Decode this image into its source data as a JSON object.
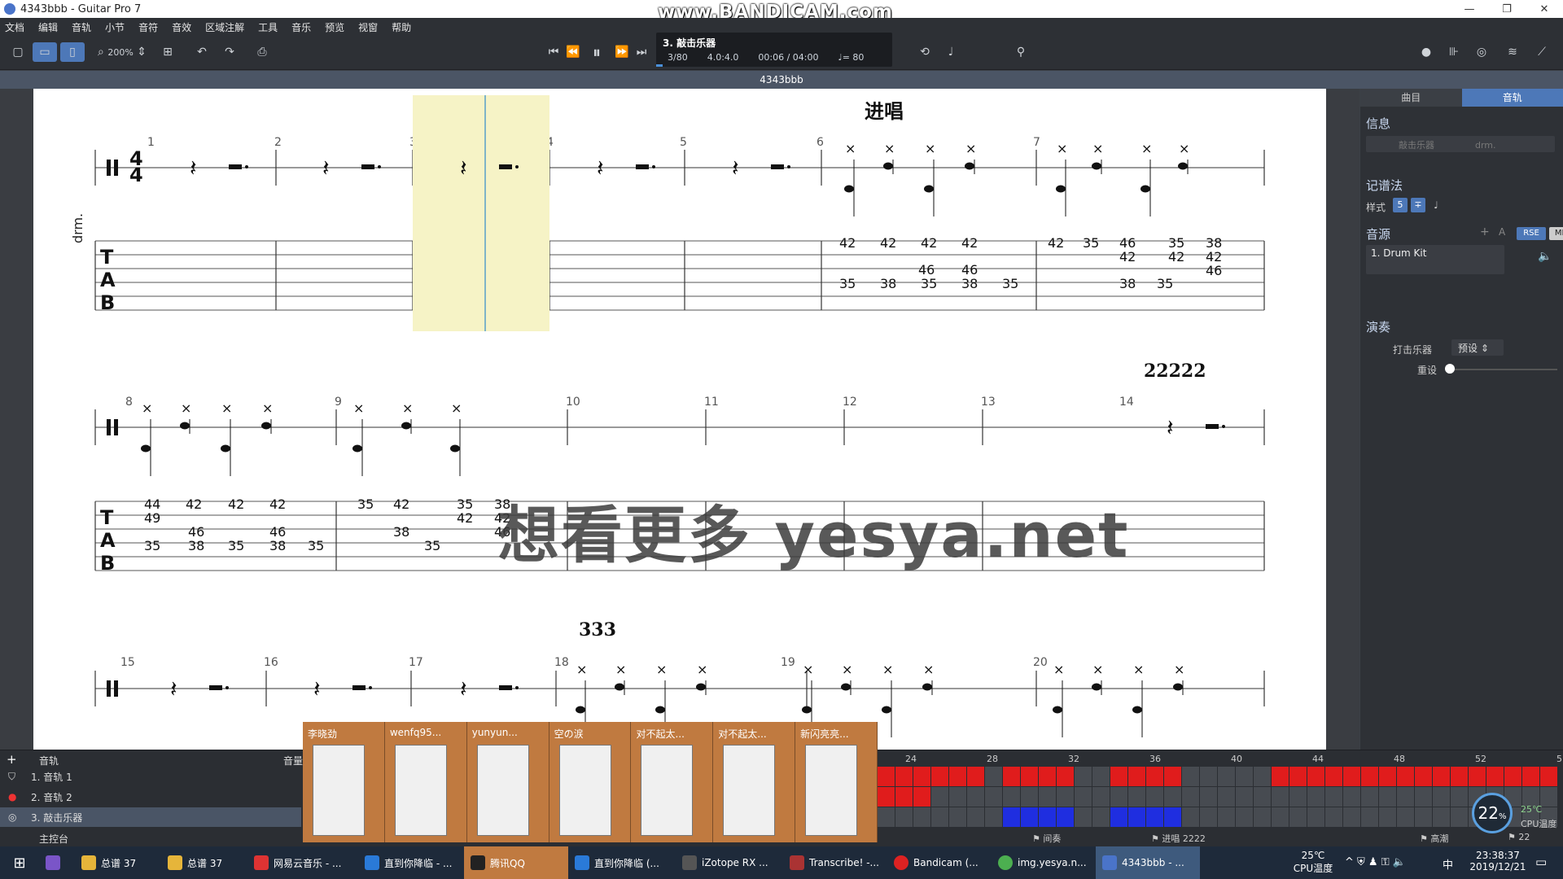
{
  "window": {
    "title": "4343bbb - Guitar Pro 7",
    "watermark": "www.BANDICAM.com"
  },
  "menu": [
    "文档",
    "编辑",
    "音轨",
    "小节",
    "音符",
    "音效",
    "区域注解",
    "工具",
    "音乐",
    "预览",
    "视窗",
    "帮助"
  ],
  "toolbar": {
    "zoom": "200%"
  },
  "lcd": {
    "track": "3. 敲击乐器",
    "bar": "3/80",
    "sig": "4.0:4.0",
    "time": "00:06 / 04:00",
    "tempo": "♩= 80"
  },
  "doc_tab": "4343bbb",
  "score": {
    "sections": [
      "进唱",
      "22222",
      "333"
    ],
    "instrument_label": "drm.",
    "bar_numbers": [
      "1",
      "2",
      "3",
      "4",
      "5",
      "6",
      "7",
      "8",
      "9",
      "10",
      "11",
      "12",
      "13",
      "14",
      "15",
      "16",
      "17",
      "18",
      "19",
      "20"
    ],
    "tab_row1": [
      "42",
      "42",
      "42",
      "42",
      "42",
      "35",
      "46",
      "35",
      "38",
      "46",
      "46",
      "42",
      "42",
      "42",
      "35",
      "38",
      "35",
      "38",
      "35",
      "38",
      "35",
      "46"
    ],
    "tab_row2": [
      "44",
      "49",
      "42",
      "42",
      "42",
      "35",
      "42",
      "35",
      "38",
      "46",
      "46",
      "42",
      "42",
      "46",
      "35",
      "38",
      "35",
      "38",
      "35",
      "38",
      "35"
    ]
  },
  "overlay_watermark": "想看更多 yesya.net",
  "right_panel": {
    "tabs": [
      "曲目",
      "音轨"
    ],
    "info": "信息",
    "track_name_placeholder": "敲击乐器",
    "short": "drm.",
    "notation": "记谱法",
    "style_label": "样式",
    "sound": "音源",
    "rse": "RSE",
    "midi": "MIDI",
    "kit": "1. Drum Kit",
    "performance": "演奏",
    "drum_label": "打击乐器",
    "preset": "预设",
    "reset": "重设"
  },
  "tracks": {
    "header": "音轨",
    "volume": "音量",
    "rows": [
      "1. 音轨 1",
      "2. 音轨 2",
      "3. 敲击乐器"
    ],
    "master": "主控台",
    "timeline": [
      "24",
      "28",
      "32",
      "36",
      "40",
      "44",
      "48",
      "52",
      "5"
    ],
    "markers": [
      "间奏",
      "进唱 2222",
      "高潮",
      "22"
    ]
  },
  "thumbs": [
    "李晓劲",
    "wenfq95...",
    "yunyun...",
    "空の涙",
    "对不起太...",
    "对不起太...",
    "新闪亮亮..."
  ],
  "cpu": {
    "percent": "22",
    "unit": "%",
    "temp": "25℃",
    "temp_label": "CPU温度"
  },
  "taskbar": {
    "items": [
      "总谱 37",
      "总谱 37",
      "网易云音乐 - ...",
      "直到你降临 - ...",
      "腾讯QQ",
      "直到你降临 (...",
      "iZotope RX ...",
      "Transcribe! -...",
      "Bandicam (...",
      "img.yesya.n...",
      "4343bbb - ..."
    ],
    "weather": "25℃",
    "weather_label": "CPU温度",
    "time": "23:38:37",
    "date": "2019/12/21",
    "lang": "中"
  }
}
